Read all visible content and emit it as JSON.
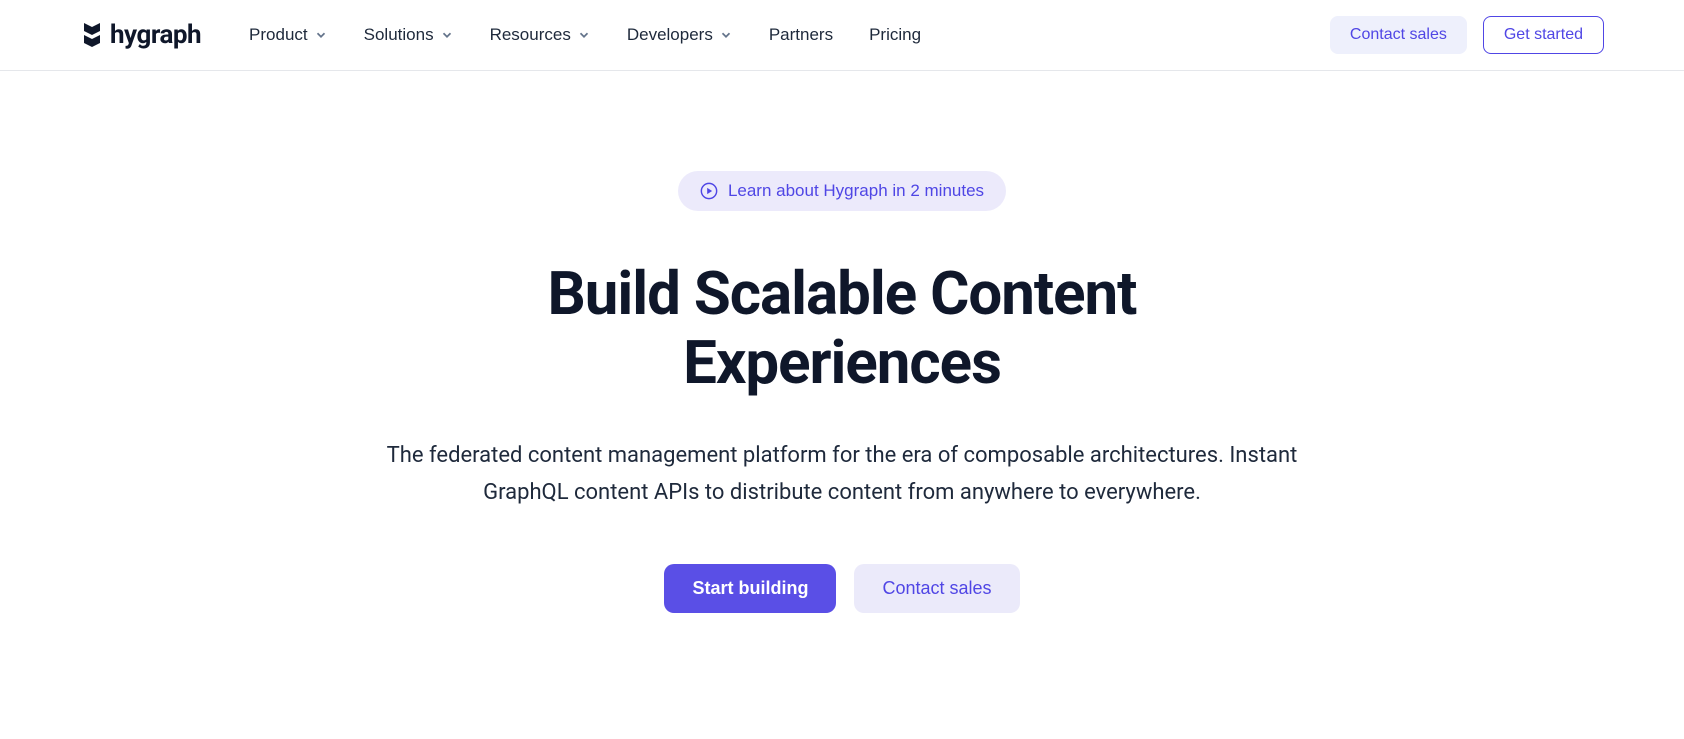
{
  "brand": {
    "name": "hygraph"
  },
  "nav": {
    "items": [
      {
        "label": "Product",
        "hasDropdown": true
      },
      {
        "label": "Solutions",
        "hasDropdown": true
      },
      {
        "label": "Resources",
        "hasDropdown": true
      },
      {
        "label": "Developers",
        "hasDropdown": true
      },
      {
        "label": "Partners",
        "hasDropdown": false
      },
      {
        "label": "Pricing",
        "hasDropdown": false
      }
    ]
  },
  "header": {
    "contactSales": "Contact sales",
    "getStarted": "Get started"
  },
  "hero": {
    "pillText": "Learn about Hygraph in 2 minutes",
    "headline": "Build Scalable Content Experiences",
    "subheadline": "The federated content management platform for the era of composable architectures. Instant GraphQL content APIs to distribute content from anywhere to everywhere.",
    "startBuilding": "Start building",
    "contactSales": "Contact sales"
  }
}
